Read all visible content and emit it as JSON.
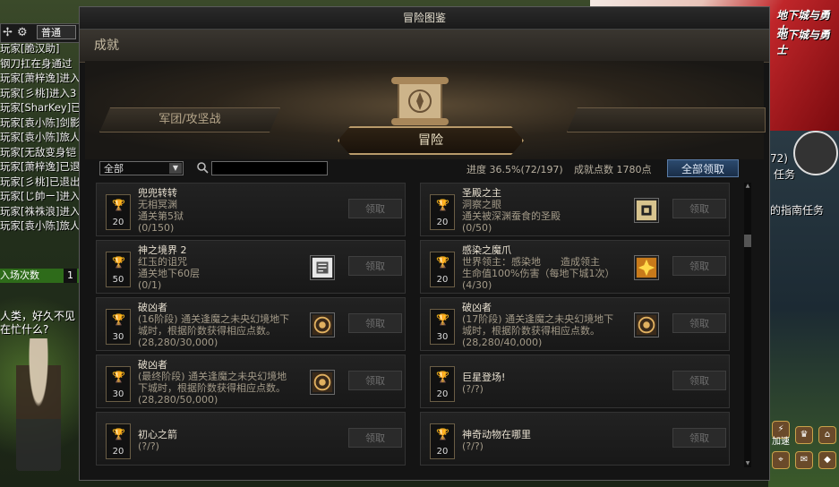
{
  "game_bg": {
    "mode_label": "普通",
    "chat_lines": [
      "玩家[脆汉助]",
      "钢刀扛在身通过",
      "玩家[萧梓逸]进入",
      "玩家[彡桃]进入3",
      "玩家[SharKey]已",
      "玩家[袁小陈]剑影",
      "玩家[袁小陈]旅人",
      "玩家[无敌变身铠",
      "玩家[萧梓逸]已退",
      "玩家[彡桃]已退出",
      "玩家[じ帥ー]进入",
      "玩家[祩祩浪]进入",
      "玩家[袁小陈]旅人"
    ],
    "entry_label": "入场次数",
    "entry_count": "1",
    "npc_lines": [
      "人类，好久不见",
      "在忙什么?"
    ],
    "right_texts": [
      "72)",
      "任务",
      "的指南任务"
    ],
    "hud_label": "加速"
  },
  "banner": {
    "logo": "地下城与勇士"
  },
  "window": {
    "title": "冒险图鉴",
    "section": "成就",
    "tabs": {
      "left": "军团/攻坚战",
      "right": "",
      "active": "冒险"
    },
    "filter": {
      "value": "全部"
    },
    "search": {
      "value": ""
    },
    "progress_label": "进度",
    "progress_value": "36.5%(72/197)",
    "points_label": "成就点数",
    "points_value": "1780点",
    "claim_all_label": "全部领取",
    "claim_label": "领取",
    "colors": {
      "accent": "#b89a6a",
      "button_blue": "#2c4a6e"
    },
    "achievements": [
      {
        "title": "兜兜转转",
        "desc": [
          "无相冥渊",
          "通关第5狱"
        ],
        "progress": "(0/150)",
        "points": "20",
        "reward": null
      },
      {
        "title": "圣殿之主",
        "desc": [
          "洞察之眼",
          "通关被深渊蚕食的圣殿"
        ],
        "progress": "(0/50)",
        "points": "20",
        "reward": "map-icon"
      },
      {
        "title": "神之境界 2",
        "desc": [
          "红玉的诅咒",
          "通关地下60层"
        ],
        "progress": "(0/1)",
        "points": "50",
        "reward": "scroll-icon"
      },
      {
        "title": "感染之魔爪",
        "desc": [
          "世界领主：感染地　　造成领主",
          "生命值100%伤害（每地下城1次）"
        ],
        "progress": "(4/30)",
        "points": "20",
        "reward": "star-icon"
      },
      {
        "title": "破凶者",
        "desc": [
          "(16阶段) 通关逢魔之未央幻境地下",
          "城时，根据阶数获得相应点数。"
        ],
        "progress": "(28,280/30,000)",
        "points": "30",
        "reward": "emblem-icon"
      },
      {
        "title": "破凶者",
        "desc": [
          "(17阶段) 通关逢魔之未央幻境地下",
          "城时，根据阶数获得相应点数。"
        ],
        "progress": "(28,280/40,000)",
        "points": "30",
        "reward": "emblem-icon"
      },
      {
        "title": "破凶者",
        "desc": [
          "(最终阶段) 通关逢魔之未央幻境地",
          "下城时，根据阶数获得相应点数。"
        ],
        "progress": "(28,280/50,000)",
        "points": "30",
        "reward": "emblem-icon"
      },
      {
        "title": "巨星登场!",
        "desc": [],
        "progress": "(?/?)",
        "points": "20",
        "reward": null
      },
      {
        "title": "初心之箭",
        "desc": [],
        "progress": "(?/?)",
        "points": "20",
        "reward": null
      },
      {
        "title": "神奇动物在哪里",
        "desc": [],
        "progress": "(?/?)",
        "points": "20",
        "reward": null
      }
    ]
  }
}
